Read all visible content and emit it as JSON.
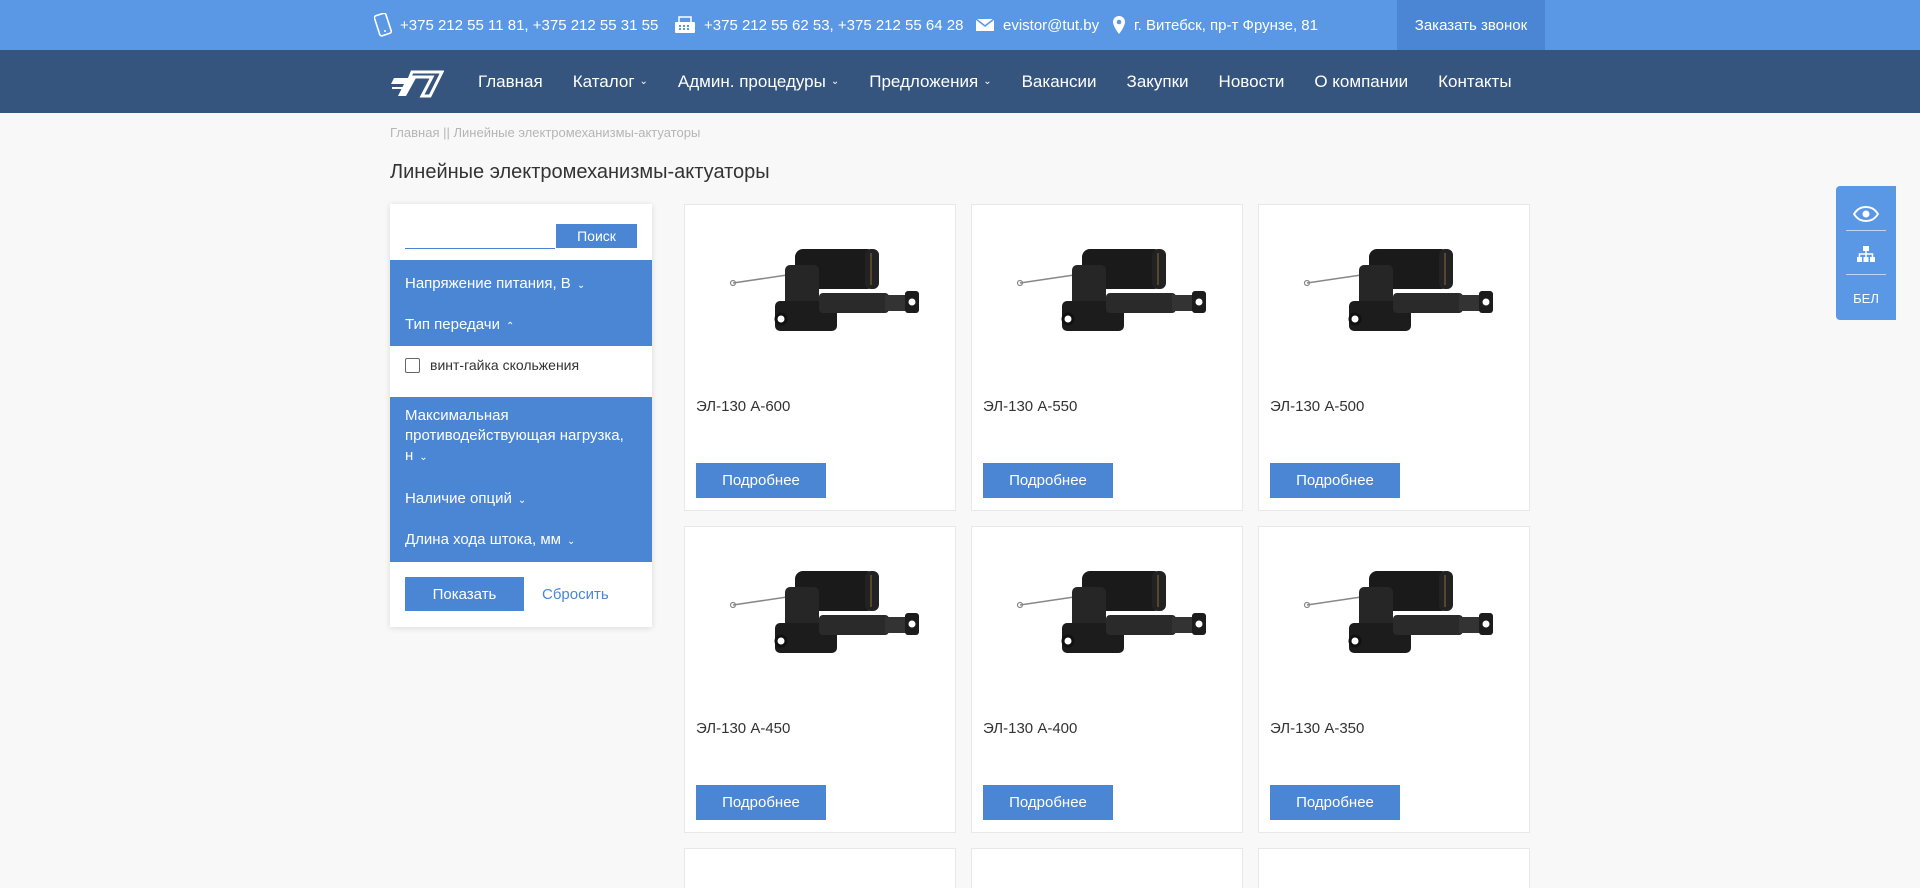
{
  "topbar": {
    "phones1": "+375 212 55 11 81, +375 212 55 31 55",
    "phones2": "+375 212 55 62 53, +375 212 55 64 28",
    "email": "evistor@tut.by",
    "address": "г. Витебск, пр-т Фрунзе, 81",
    "callback_label": "Заказать звонок",
    "icons": [
      "mobile-phone-icon",
      "fax-icon",
      "mail-icon",
      "location-pin-icon"
    ]
  },
  "nav": {
    "items": [
      {
        "label": "Главная",
        "dropdown": false
      },
      {
        "label": "Каталог",
        "dropdown": true
      },
      {
        "label": "Админ. процедуры",
        "dropdown": true
      },
      {
        "label": "Предложения",
        "dropdown": true
      },
      {
        "label": "Вакансии",
        "dropdown": false
      },
      {
        "label": "Закупки",
        "dropdown": false
      },
      {
        "label": "Новости",
        "dropdown": false
      },
      {
        "label": "О компании",
        "dropdown": false
      },
      {
        "label": "Контакты",
        "dropdown": false
      }
    ]
  },
  "breadcrumb": {
    "home": "Главная",
    "sep": "||",
    "current": "Линейные электромеханизмы-актуаторы"
  },
  "page_title": "Линейные электромеханизмы-актуаторы",
  "filter": {
    "search_value": "",
    "search_button": "Поиск",
    "groups": [
      {
        "title": "Напряжение питания, В",
        "expanded": false
      },
      {
        "title": "Тип передачи",
        "expanded": true
      },
      {
        "title": "Максимальная противодействующая нагрузка, н",
        "expanded": false
      },
      {
        "title": "Наличие опций",
        "expanded": false
      },
      {
        "title": "Длина хода штока, мм",
        "expanded": false
      }
    ],
    "options": [
      {
        "label": "винт-гайка скольжения",
        "checked": false
      }
    ],
    "show_button": "Показать",
    "reset_link": "Сбросить"
  },
  "products": [
    {
      "name": "ЭЛ-130 А-600",
      "button": "Подробнее"
    },
    {
      "name": "ЭЛ-130 А-550",
      "button": "Подробнее"
    },
    {
      "name": "ЭЛ-130 А-500",
      "button": "Подробнее"
    },
    {
      "name": "ЭЛ-130 А-450",
      "button": "Подробнее"
    },
    {
      "name": "ЭЛ-130 А-400",
      "button": "Подробнее"
    },
    {
      "name": "ЭЛ-130 А-350",
      "button": "Подробнее"
    }
  ],
  "sidepanel": {
    "icons": [
      "eye-icon",
      "sitemap-icon"
    ],
    "lang_label": "БЕЛ"
  },
  "colors": {
    "topbar": "#5a98e6",
    "nav": "#35557f",
    "accent": "#4a86d3"
  }
}
